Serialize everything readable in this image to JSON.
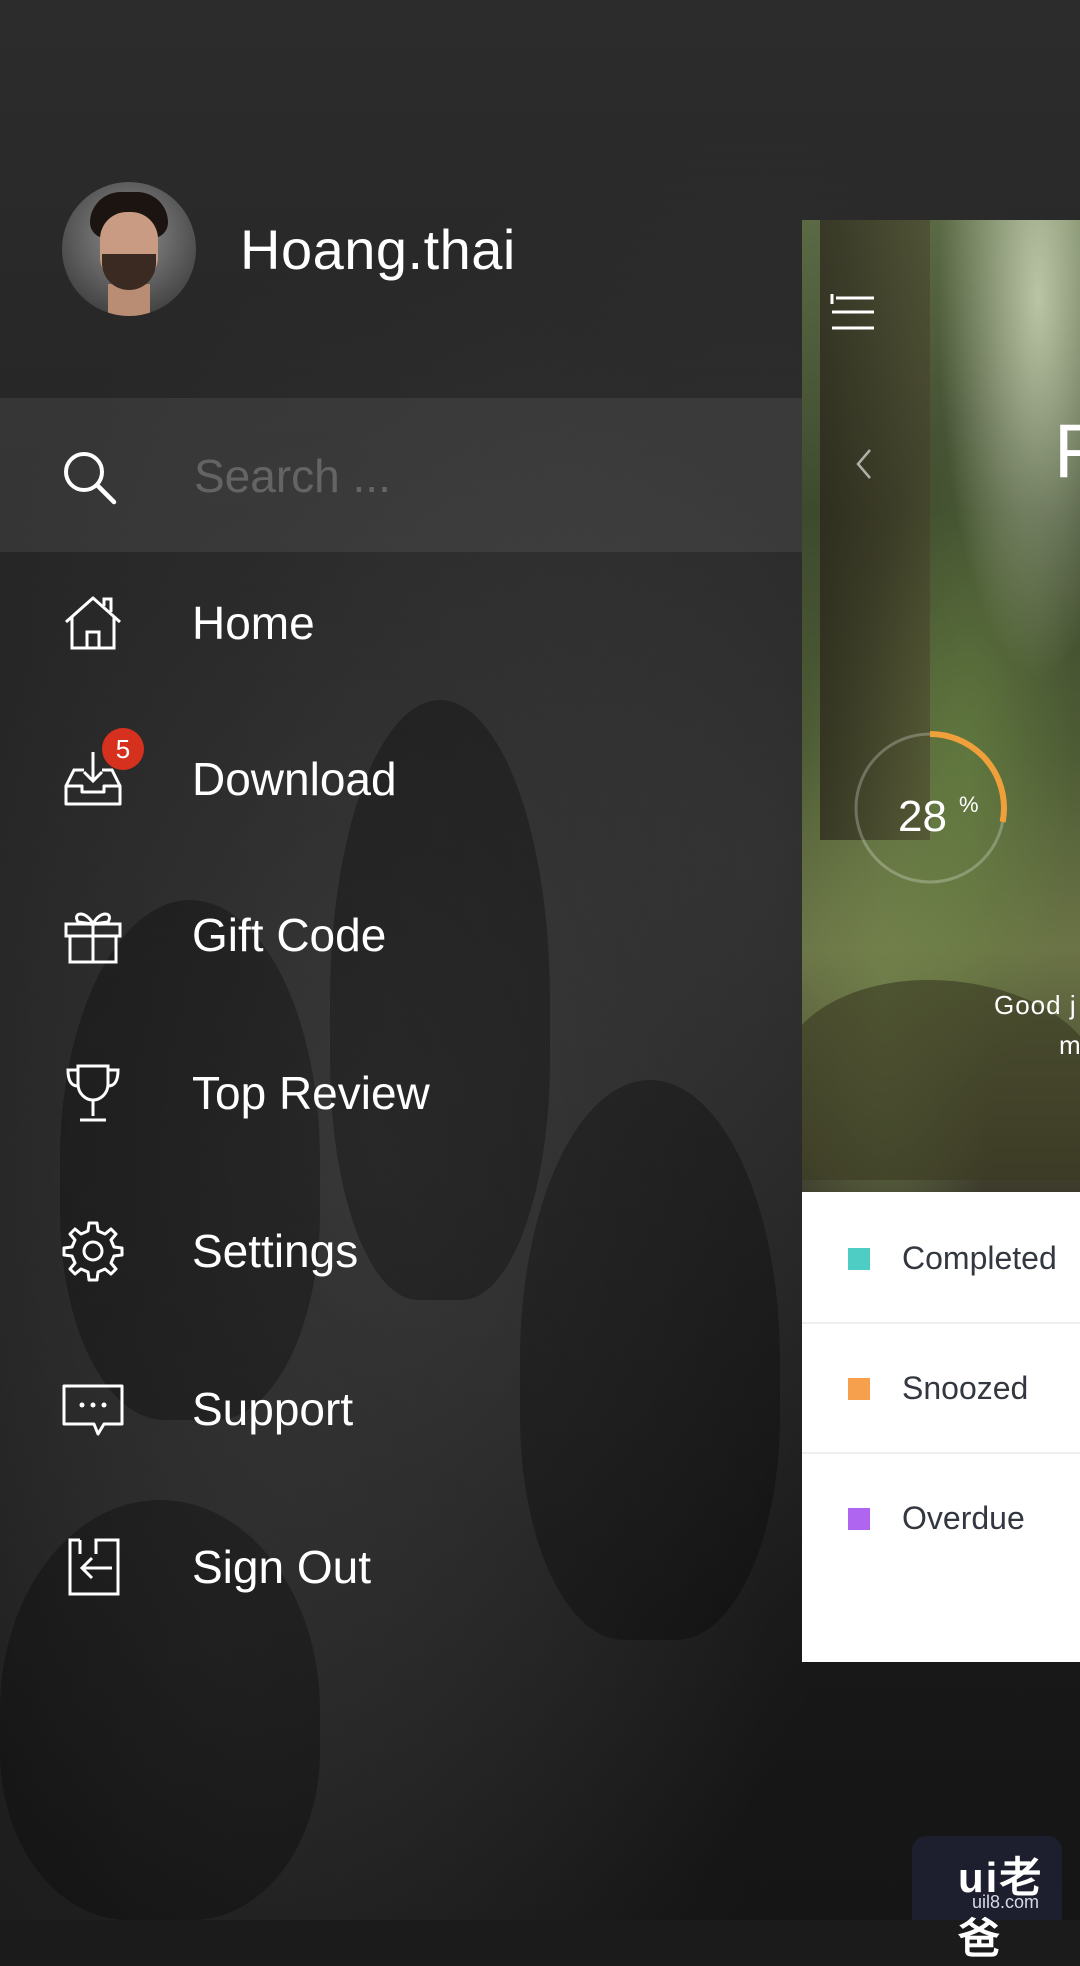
{
  "profile": {
    "username": "Hoang.thai"
  },
  "search": {
    "placeholder": "Search ..."
  },
  "menu": {
    "items": [
      {
        "label": "Home",
        "icon": "home-icon"
      },
      {
        "label": "Download",
        "icon": "inbox-download-icon",
        "badge": "5"
      },
      {
        "label": "Gift Code",
        "icon": "gift-icon"
      },
      {
        "label": "Top Review",
        "icon": "trophy-icon"
      },
      {
        "label": "Settings",
        "icon": "gear-icon"
      },
      {
        "label": "Support",
        "icon": "chat-icon"
      },
      {
        "label": "Sign Out",
        "icon": "sign-out-icon"
      }
    ]
  },
  "screen": {
    "title_fragment": "F",
    "progress": {
      "value": "28",
      "unit": "%",
      "fraction": 0.28
    },
    "greeting_line1": "Good j",
    "greeting_line2": "m",
    "legend": [
      {
        "label": "Completed",
        "color": "#4ecdc4"
      },
      {
        "label": "Snoozed",
        "color": "#f6a04d"
      },
      {
        "label": "Overdue",
        "color": "#b065f0"
      }
    ]
  },
  "colors": {
    "badge": "#d6301f",
    "progress_arc": "#f0a03a"
  },
  "watermark": {
    "logo": "ui老爸",
    "url": "uil8.com"
  }
}
